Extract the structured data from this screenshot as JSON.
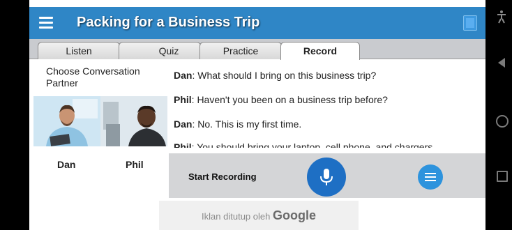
{
  "app_bar": {
    "title": "Packing for a Business Trip",
    "accent_color": "#2f86c6",
    "menu_icon": "hamburger-menu-icon",
    "book_icon": "book-icon"
  },
  "tabs": [
    {
      "label": "Listen",
      "active": false
    },
    {
      "label": "Quiz",
      "active": false
    },
    {
      "label": "Practice",
      "active": false
    },
    {
      "label": "Record",
      "active": true
    }
  ],
  "partner_panel": {
    "label": "Choose Conversation Partner",
    "partners": [
      {
        "name": "Dan"
      },
      {
        "name": "Phil"
      }
    ]
  },
  "transcript": [
    {
      "speaker": "Dan",
      "text": ": What should I bring on this business trip?"
    },
    {
      "speaker": "Phil",
      "text": ": Haven't you been on a business trip before?"
    },
    {
      "speaker": "Dan",
      "text": ": No.  This is my first time."
    },
    {
      "speaker": "Phil",
      "text": ": You should bring your laptop, cell phone, and chargers"
    }
  ],
  "recorder": {
    "start_label": "Start Recording",
    "mic_icon": "microphone-icon",
    "list_icon": "list-icon",
    "mic_color": "#1e6fc4",
    "list_color": "#2d93dd"
  },
  "ad": {
    "text": "Iklan ditutup oleh ",
    "brand": "Google"
  },
  "system_nav": {
    "icons": [
      "accessibility-icon",
      "back-icon",
      "home-icon",
      "recent-apps-icon"
    ]
  }
}
